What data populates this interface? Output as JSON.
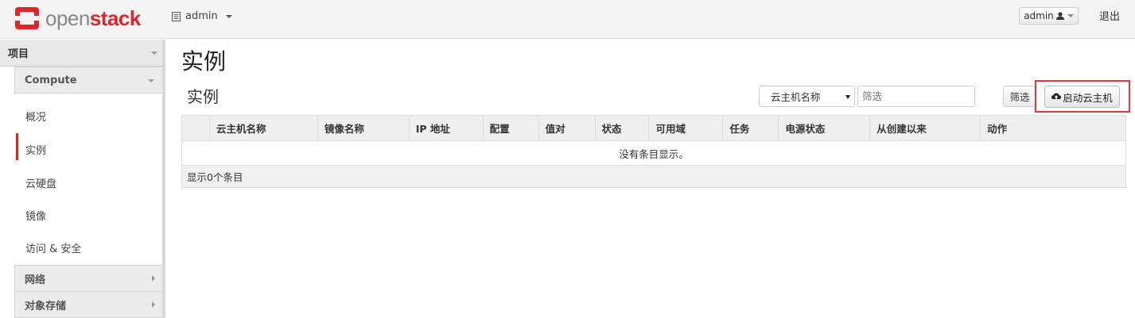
{
  "app": {
    "logo_open": "open",
    "logo_stack": "stack",
    "brand_color": "#d9282c"
  },
  "header": {
    "project": "admin",
    "user": "admin",
    "logout": "退出"
  },
  "sidebar": {
    "section": "项目",
    "compute": "Compute",
    "items": [
      {
        "label": "概况"
      },
      {
        "label": "实例",
        "active": true
      },
      {
        "label": "云硬盘"
      },
      {
        "label": "镜像"
      },
      {
        "label": "访问 & 安全"
      }
    ],
    "network": "网络",
    "object_store": "对象存储"
  },
  "main": {
    "page_title": "实例",
    "table_title": "实例",
    "filter_select": "云主机名称",
    "filter_placeholder": "筛选",
    "filter_button": "筛选",
    "launch_button": "启动云主机",
    "columns": [
      "",
      "云主机名称",
      "镜像名称",
      "IP 地址",
      "配置",
      "值对",
      "状态",
      "可用域",
      "任务",
      "电源状态",
      "从创建以来",
      "动作"
    ],
    "empty_text": "没有条目显示。",
    "footer_text": "显示0个条目"
  }
}
